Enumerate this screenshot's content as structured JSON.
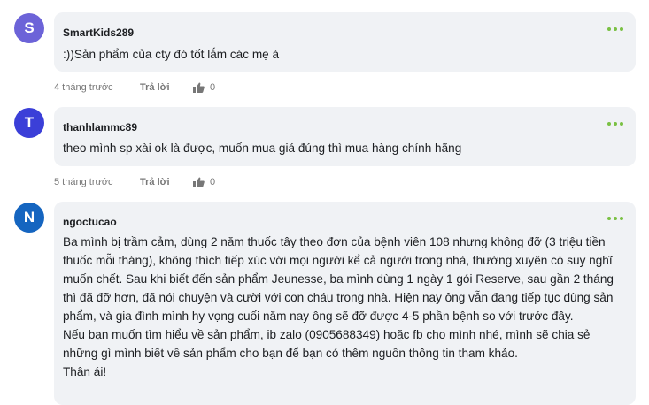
{
  "comments": [
    {
      "avatar_letter": "S",
      "avatar_color": "#6c63d8",
      "username": "SmartKids289",
      "lines": [
        ":))Sản phẩm của cty đó tốt lắm các mẹ à"
      ],
      "time": "4 tháng trước",
      "reply": "Trả lời",
      "likes": "0"
    },
    {
      "avatar_letter": "T",
      "avatar_color": "#3b3fd8",
      "username": "thanhlammc89",
      "lines": [
        "theo mình sp xài ok là được, muốn mua giá đúng thì mua hàng chính hãng"
      ],
      "time": "5 tháng trước",
      "reply": "Trả lời",
      "likes": "0"
    },
    {
      "avatar_letter": "N",
      "avatar_color": "#1565c0",
      "username": "ngoctucao",
      "lines": [
        "Ba mình bị trầm cảm, dùng 2 năm thuốc tây theo đơn của bệnh viên 108 nhưng không đỡ (3 triệu tiền",
        "thuốc mỗi tháng), không thích tiếp xúc với mọi người kể cả người trong nhà, thường xuyên có suy nghĩ",
        "muốn chết. Sau khi biết đến sản phẩm Jeunesse, ba mình dùng 1 ngày 1 gói Reserve, sau gần 2 tháng",
        "thì đã đỡ hơn, đã nói chuyện và cười với con cháu trong nhà. Hiện nay ông vẫn đang tiếp tục dùng sản",
        "phẩm, và gia đình mình hy vọng cuối năm nay ông sẽ đỡ được 4-5 phần bệnh so với trước đây.",
        "Nếu bạn muốn tìm hiểu về sản phẩm, ib zalo (0905688349) hoặc fb cho mình nhé, mình sẽ chia sẻ",
        "những gì mình biết về sản phẩm cho bạn để bạn có thêm nguồn thông tin tham khảo.",
        "Thân ái!"
      ]
    }
  ]
}
